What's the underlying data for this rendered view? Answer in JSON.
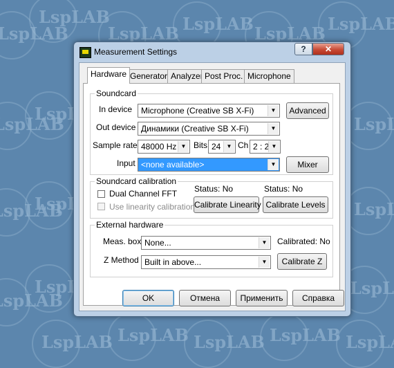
{
  "watermark": "LspLAB",
  "window": {
    "title": "Measurement Settings",
    "help_glyph": "?",
    "close_glyph": "✕"
  },
  "tabs": [
    "Hardware",
    "Generator",
    "Analyzer",
    "Post Proc.",
    "Microphone"
  ],
  "soundcard": {
    "group_label": "Soundcard",
    "in_device_label": "In device",
    "in_device_value": "Microphone (Creative SB X-Fi)",
    "out_device_label": "Out device",
    "out_device_value": "Динамики (Creative SB X-Fi)",
    "sample_rate_label": "Sample rate",
    "sample_rate_value": "48000 Hz",
    "bits_label": "Bits",
    "bits_value": "24",
    "ch_label": "Ch",
    "ch_value": "2 : 2",
    "input_label": "Input",
    "input_value": "<none available>",
    "advanced_label": "Advanced",
    "mixer_label": "Mixer"
  },
  "calibration": {
    "group_label": "Soundcard calibration",
    "dual_fft_label": "Dual Channel FFT",
    "linearity_label": "Use linearity calibration",
    "status_linearity": "Status:  No",
    "status_levels": "Status:  No",
    "calibrate_linearity_label": "Calibrate Linearity",
    "calibrate_levels_label": "Calibrate Levels"
  },
  "external": {
    "group_label": "External hardware",
    "meas_box_label": "Meas. box",
    "meas_box_value": "None...",
    "calibrated_text": "Calibrated:  No",
    "z_method_label": "Z Method",
    "z_method_value": "Built in above...",
    "calibrate_z_label": "Calibrate Z"
  },
  "footer": {
    "ok": "OK",
    "cancel": "Отмена",
    "apply": "Применить",
    "help": "Справка"
  },
  "icons": {
    "dropdown_arrow": "▼"
  }
}
